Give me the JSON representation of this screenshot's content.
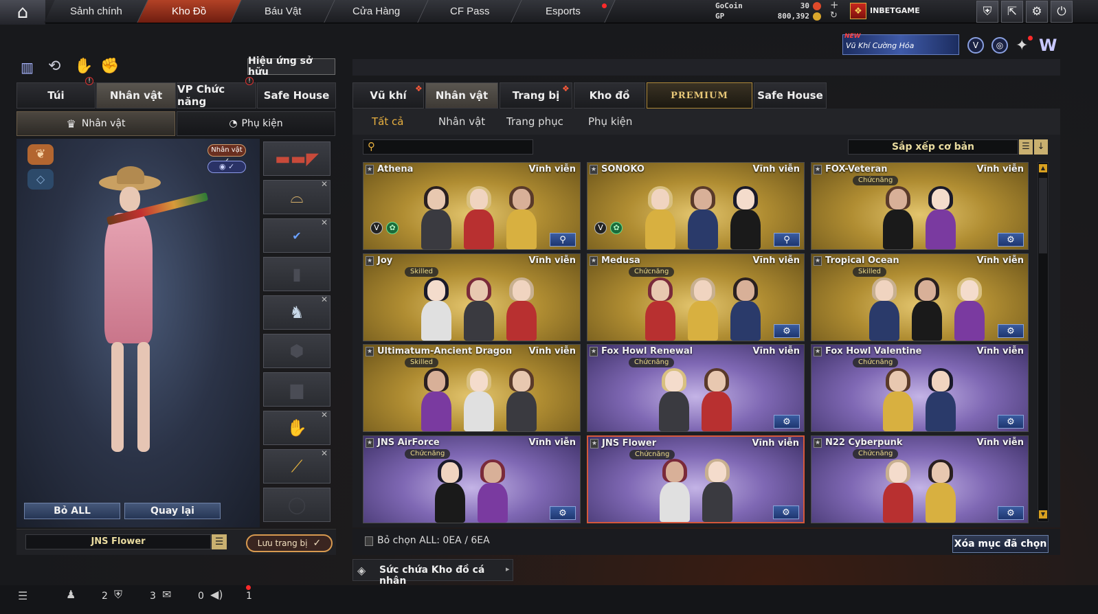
{
  "topnav": {
    "tabs": [
      "Sảnh chính",
      "Kho Đồ",
      "Báu Vật",
      "Cửa Hàng",
      "CF Pass",
      "Esports"
    ],
    "active": "Kho Đồ"
  },
  "currency": {
    "gocoin_label": "GoCoin",
    "gp_label": "GP",
    "gocoin_value": "30",
    "gp_value": "800,392"
  },
  "user": {
    "name": "INBETGAME"
  },
  "promo": {
    "badge": "NEW",
    "text": "Vũ Khí Cường Hóa"
  },
  "left": {
    "effects_button": "Hiệu ứng sở hữu",
    "tabs": [
      "Túi",
      "Nhân vật",
      "VP Chức năng",
      "Safe House"
    ],
    "subtabs": [
      "Nhân vật",
      "Phụ kiện"
    ],
    "char_badge": "Nhân vật",
    "remove_all": "Bỏ ALL",
    "back": "Quay lại",
    "loadout_name": "JNS Flower",
    "save_loadout": "Lưu trang bị"
  },
  "right": {
    "tabs": [
      "Vũ khí",
      "Nhân vật",
      "Trang bị",
      "Kho đồ",
      "PREMIUM",
      "Safe House"
    ],
    "categories": [
      "Tất cả",
      "Nhân vật",
      "Trang phục",
      "Phụ kiện"
    ],
    "search_placeholder": "",
    "sort_label": "Sắp xếp cơ bản",
    "items": [
      {
        "name": "Athena",
        "duration": "Vĩnh viễn",
        "tag": "",
        "theme": "gold"
      },
      {
        "name": "SONOKO",
        "duration": "Vĩnh viễn",
        "tag": "",
        "theme": "gold"
      },
      {
        "name": "FOX-Veteran",
        "duration": "Vĩnh viễn",
        "tag": "Chứcnăng",
        "theme": "gold"
      },
      {
        "name": "Joy",
        "duration": "Vĩnh viễn",
        "tag": "Skilled",
        "theme": "gold"
      },
      {
        "name": "Medusa",
        "duration": "Vĩnh viễn",
        "tag": "Chứcnăng",
        "theme": "gold"
      },
      {
        "name": "Tropical Ocean",
        "duration": "Vĩnh viễn",
        "tag": "Skilled",
        "theme": "gold"
      },
      {
        "name": "Ultimatum-Ancient Dragon",
        "duration": "Vĩnh viễn",
        "tag": "Skilled",
        "theme": "gold"
      },
      {
        "name": "Fox Howl Renewal",
        "duration": "Vĩnh viễn",
        "tag": "Chứcnăng",
        "theme": "purple"
      },
      {
        "name": "Fox Howl Valentine",
        "duration": "Vĩnh viễn",
        "tag": "Chứcnăng",
        "theme": "purple"
      },
      {
        "name": "JNS AirForce",
        "duration": "Vĩnh viễn",
        "tag": "Chứcnăng",
        "theme": "purple"
      },
      {
        "name": "JNS Flower",
        "duration": "Vĩnh viễn",
        "tag": "Chứcnăng",
        "theme": "purple"
      },
      {
        "name": "N22 Cyberpunk",
        "duration": "Vĩnh viễn",
        "tag": "Chứcnăng",
        "theme": "purple"
      }
    ],
    "deselect_all": "Bỏ chọn ALL: 0EA / 6EA",
    "delete_selected": "Xóa mục đã chọn",
    "capacity": "Sức chứa Kho đồ cá nhân"
  },
  "statusbar": {
    "count1": "2",
    "count2": "3",
    "count3": "0",
    "count4": "1"
  },
  "colors": {
    "accent": "#b24226",
    "gold_card": "#b08d32",
    "purple_card": "#7f68b4",
    "selection": "#d6583b"
  }
}
